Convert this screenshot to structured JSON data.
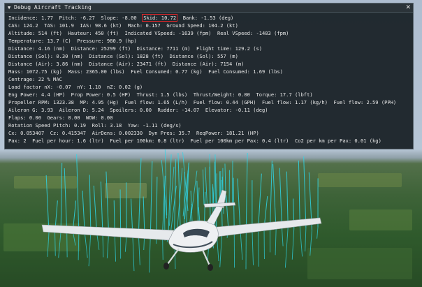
{
  "window": {
    "title": "Debug Aircraft Tracking",
    "collapse_icon": "triangle-down-icon",
    "close_icon": "close-icon"
  },
  "stats": {
    "lines": [
      {
        "segments": [
          {
            "text": "Incidence: 1.77  Pitch: -6.27  Slope: -8.00  ",
            "highlight": false
          },
          {
            "text": "Skid: 10.72",
            "highlight": true
          },
          {
            "text": "  Bank: -1.53 (deg)",
            "highlight": false
          }
        ]
      },
      {
        "segments": [
          {
            "text": "CAS: 124.2  TAS: 101.9  IAS: 98.6 (kt)  Mach: 0.157  Ground Speed: 104.2 (kt)",
            "highlight": false
          }
        ]
      },
      {
        "segments": [
          {
            "text": "Altitude: 514 (ft)  Hauteur: 450 (ft)  Indicated VSpeed: -1639 (fpm)  Real VSpeed: -1483 (fpm)",
            "highlight": false
          }
        ]
      },
      {
        "segments": [
          {
            "text": "Temperature: 13.7 (C)  Pressure: 980.9 (hp)",
            "highlight": false
          }
        ]
      },
      {
        "segments": [
          {
            "text": "Distance: 4.16 (nm)  Distance: 25299 (ft)  Distance: 7711 (m)  Flight time: 129.2 (s)",
            "highlight": false
          }
        ]
      },
      {
        "segments": [
          {
            "text": "Distance (Sol): 0.30 (nm)  Distance (Sol): 1828 (ft)  Distance (Sol): 557 (m)",
            "highlight": false
          }
        ]
      },
      {
        "segments": [
          {
            "text": "Distance (Air): 3.86 (nm)  Distance (Air): 23471 (ft)  Distance (Air): 7154 (m)",
            "highlight": false
          }
        ]
      },
      {
        "segments": [
          {
            "text": "Mass: 1072.75 (kg)  Mass: 2365.00 (lbs)  Fuel Consumed: 0.77 (kg)  Fuel Consumed: 1.69 (lbs)",
            "highlight": false
          }
        ]
      },
      {
        "segments": [
          {
            "text": "Centrage: 22 % MAC",
            "highlight": false
          }
        ]
      },
      {
        "segments": [
          {
            "text": "Load factor nX: -0.07  nY: 1.10  nZ: 0.02 (g)",
            "highlight": false
          }
        ]
      },
      {
        "segments": [
          {
            "text": "Eng Power: 4.4 (HP)  Prop Power: 0.5 (HP)  Thrust: 1.5 (lbs)  Thrust/Weight: 0.00  Torque: 17.7 (lbft)",
            "highlight": false
          }
        ]
      },
      {
        "segments": [
          {
            "text": "Propeller RPM: 1323.38  MP: 4.95 (Hg)  Fuel flow: 1.65 (L/h)  Fuel flow: 0.44 (GPH)  Fuel flow: 1.17 (kg/h)  Fuel flow: 2.59 (PPH)",
            "highlight": false
          }
        ]
      },
      {
        "segments": [
          {
            "text": "Aileron G: 3.93  Aileron D: 5.24  Spoilers: 0.00  Rudder: -14.07  Elevator: -0.11 (deg)",
            "highlight": false
          }
        ]
      },
      {
        "segments": [
          {
            "text": "Flaps: 0.00  Gears: 0.00  WOW: 0.00",
            "highlight": false
          }
        ]
      },
      {
        "segments": [
          {
            "text": "Rotation Speed Pitch: 0.19  Roll: 3.18  Yaw: -1.11 (deg/s)",
            "highlight": false
          }
        ]
      },
      {
        "segments": [
          {
            "text": "Cx: 0.053407  Cz: 0.415347  AirDens: 0.002330  Dyn Pres: 35.7  ReqPower: 181.21 (HP)",
            "highlight": false
          }
        ]
      },
      {
        "segments": [
          {
            "text": "Pax: 2  Fuel per hour: 1.6 (ltr)  Fuel per 100km: 0.8 (ltr)  Fuel per 100km per Pax: 0.4 (ltr)  Co2 per km per Pax: 0.01 (kg)",
            "highlight": false
          }
        ]
      }
    ]
  },
  "colors": {
    "panel_bg": "#171e24",
    "highlight_box": "#e0262a",
    "force_vectors": "#2fd6e8",
    "aircraft_body": "#e9ecef"
  }
}
